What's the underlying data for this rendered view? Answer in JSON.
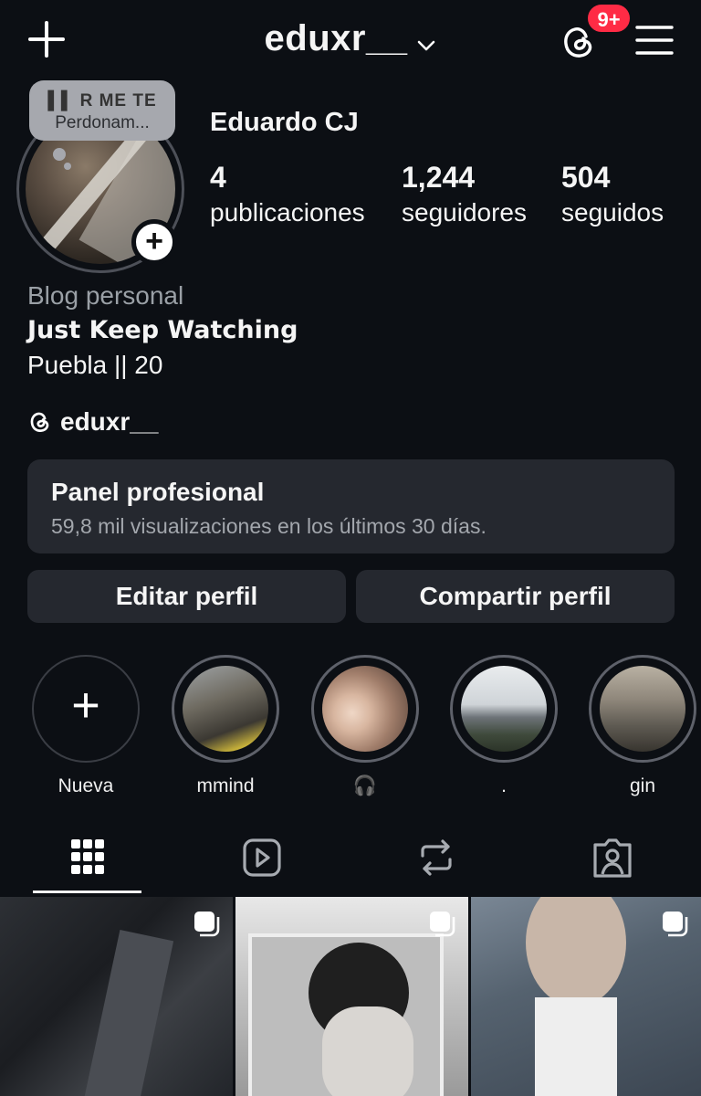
{
  "header": {
    "username": "eduxr__",
    "badge": "9+"
  },
  "note": {
    "music_label": "R ME TE",
    "song": "Perdonam..."
  },
  "profile": {
    "full_name": "Eduardo CJ",
    "stats": [
      {
        "num": "4",
        "label": "publicaciones"
      },
      {
        "num": "1,244",
        "label": "seguidores"
      },
      {
        "num": "504",
        "label": "seguidos"
      }
    ],
    "category": "Blog personal",
    "bio_line1": "Just Keep Watching",
    "bio_line2": "Puebla || 20",
    "threads_handle": "eduxr__"
  },
  "panel": {
    "title": "Panel profesional",
    "subtitle": "59,8 mil visualizaciones en los últimos 30 días."
  },
  "buttons": {
    "edit": "Editar perfil",
    "share": "Compartir perfil"
  },
  "highlights": [
    {
      "label": "Nueva"
    },
    {
      "label": "mmind"
    },
    {
      "label": "🎧"
    },
    {
      "label": "."
    },
    {
      "label": "gin"
    }
  ],
  "colors": {
    "background": "#0c0f14",
    "card": "#25282f",
    "badge": "#ff2b45"
  }
}
